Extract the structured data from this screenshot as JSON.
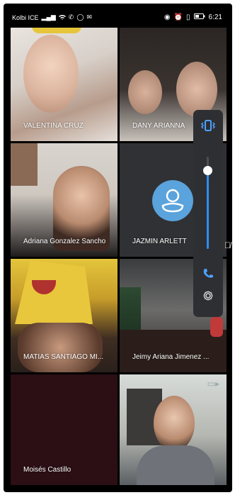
{
  "status_bar": {
    "carrier": "Kolbi ICE",
    "time": "6:21",
    "icons": [
      "signal-icon",
      "wifi-icon",
      "phone-icon",
      "whatsapp-icon",
      "mail-icon",
      "eye-icon",
      "alarm-icon",
      "vibrate-icon",
      "battery-icon"
    ]
  },
  "participants": [
    {
      "name": "VALENTINA CRUZ ...",
      "label": "VALENTINA CRUZ"
    },
    {
      "name": "DANY ARIANNA ...",
      "label": "DANY ARIANNA"
    },
    {
      "name": "Adriana Gonzalez Sancho",
      "label": "Adriana Gonzalez Sancho"
    },
    {
      "name": "JAZMIN ARLETTE",
      "label": "JAZMIN ARLETT"
    },
    {
      "name": "MATIAS SANTIAGO MI...",
      "label": "MATIAS SANTIAGO MI..."
    },
    {
      "name": "Jeimy Ariana Jimenez ...",
      "label": "Jeimy Ariana Jimenez ..."
    },
    {
      "name": "Moisés Castillo",
      "label": "Moisés Castillo"
    },
    {
      "name": "",
      "label": ""
    }
  ],
  "controls": {
    "volume_level": 0.85,
    "colors": {
      "accent": "#2f8df5",
      "panel": "#2d2f33",
      "avatar": "#5aa3dc"
    }
  }
}
